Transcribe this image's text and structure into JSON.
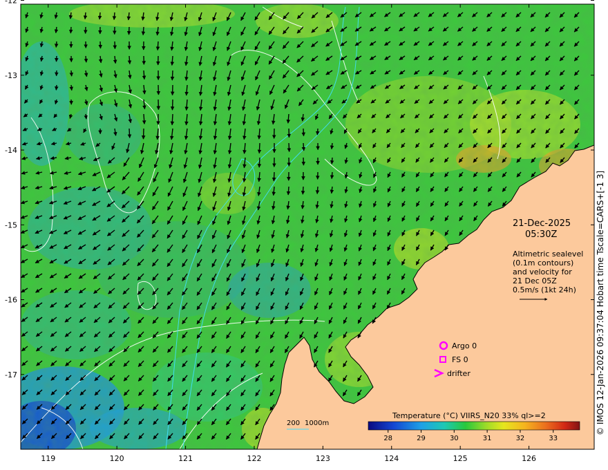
{
  "map": {
    "lon_ticks": [
      "119",
      "120",
      "121",
      "122",
      "123",
      "124",
      "125",
      "126"
    ],
    "lat_ticks": [
      "-12",
      "-13",
      "-14",
      "-15",
      "-16",
      "-17"
    ],
    "lon_range": [
      118.6,
      126.95
    ],
    "lat_range": [
      -12.05,
      -18.0
    ]
  },
  "annotation": {
    "date": "21-Dec-2025",
    "time": "05:30Z",
    "lines": [
      "Altimetric sealevel",
      "(0.1m contours)",
      "and velocity for",
      "21 Dec 05Z",
      "0.5m/s (1kt 24h)"
    ]
  },
  "legend": {
    "argo": "Argo 0",
    "fs": "FS 0",
    "drifter": "drifter",
    "marker_color": "#ff00ff"
  },
  "depth": {
    "label_200": "200",
    "label_1000": "1000m",
    "color": "#40e0ff"
  },
  "colorbar": {
    "title": "Temperature (°C) VIIRS_N20 33% ql>=2",
    "ticks": [
      "28",
      "29",
      "30",
      "31",
      "32",
      "33"
    ]
  },
  "side_caption": "© IMOS 12-Jan-2026 09:37:04 Hobart time Tscale=CARS+[-1 3]",
  "colors": {
    "land": "#fcc99c",
    "coast": "#000000",
    "sst_dominant": "#3cc83c"
  }
}
